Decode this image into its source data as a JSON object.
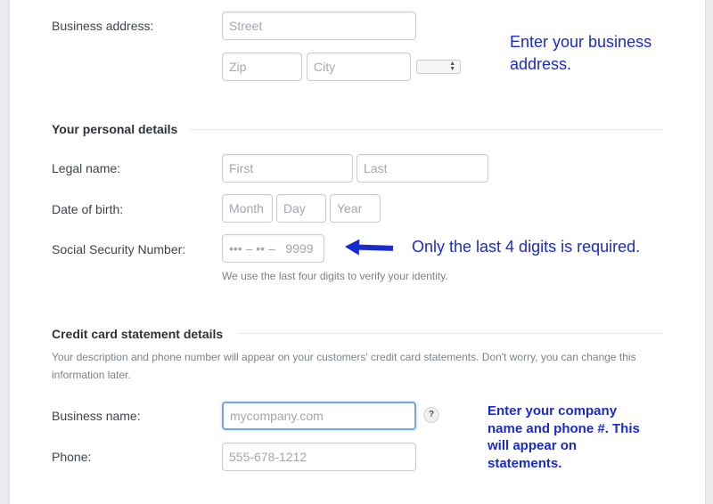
{
  "business_address": {
    "label": "Business address:",
    "street_placeholder": "Street",
    "zip_placeholder": "Zip",
    "city_placeholder": "City"
  },
  "personal": {
    "title": "Your personal details",
    "legal_name_label": "Legal name:",
    "first_placeholder": "First",
    "last_placeholder": "Last",
    "dob_label": "Date of birth:",
    "month_placeholder": "Month",
    "day_placeholder": "Day",
    "year_placeholder": "Year",
    "ssn_label": "Social Security Number:",
    "ssn_placeholder": "••• – •• –   9999",
    "ssn_hint": "We use the last four digits to verify your identity."
  },
  "statement": {
    "title": "Credit card statement details",
    "description": "Your description and phone number will appear on your customers' credit card statements. Don't worry, you can change this information later.",
    "business_name_label": "Business name:",
    "business_name_placeholder": "mycompany.com",
    "help_glyph": "?",
    "phone_label": "Phone:",
    "phone_placeholder": "555-678-1212"
  },
  "annotations": {
    "address_note": "Enter your business address.",
    "ssn_note": "Only the last 4 digits is required.",
    "company_note": "Enter your company name and phone #. This will appear on statements."
  },
  "colors": {
    "annotation": "#1a2ad1",
    "focus_border": "#79a6d8"
  }
}
